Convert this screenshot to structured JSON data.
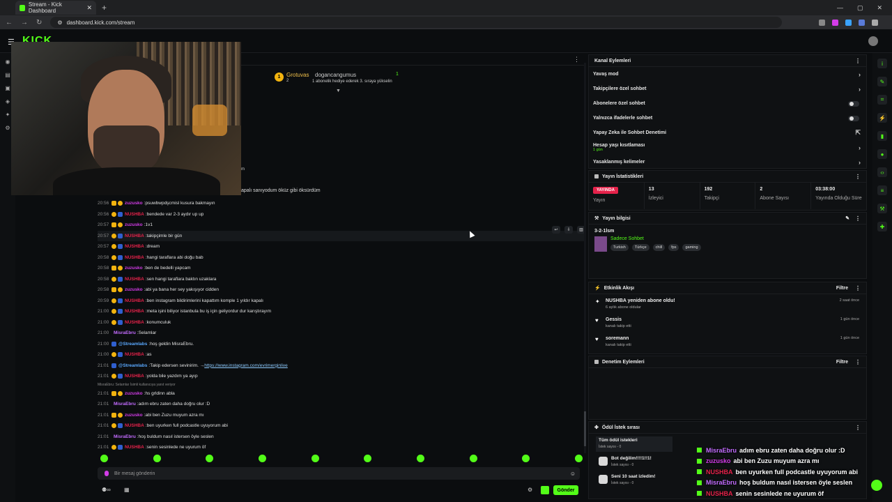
{
  "browser": {
    "tab_title": "Stream - Kick Dashboard",
    "url": "dashboard.kick.com/stream"
  },
  "site": {
    "logo": "KICK"
  },
  "pinned": {
    "rank": "1",
    "user1": "Grotuvas",
    "count1": "2",
    "user2": "dogancangumus",
    "count2": "1",
    "sub_text": "1 abonelik hediye ederek 3. sıraya yükselin"
  },
  "chat": {
    "fragment_top": "apalı sanıyodum öküz gibi öksürdüm",
    "fragment_mid": "m",
    "messages": [
      {
        "time": "20:56",
        "user": "zuzusko",
        "color": "#d33ce8",
        "badges": [
          "crown",
          "sub"
        ],
        "text": "psuwbwpdşcmisl kusura bakmayın"
      },
      {
        "time": "20:56",
        "user": "NUSHBA",
        "color": "#e5224a",
        "badges": [
          "sub",
          "blue"
        ],
        "text": "bendede var 2-3 aydır up up"
      },
      {
        "time": "20:57",
        "user": "zuzusko",
        "color": "#d33ce8",
        "badges": [
          "crown",
          "sub"
        ],
        "text": "1v1"
      },
      {
        "time": "20:57",
        "user": "NUSHBA",
        "color": "#e5224a",
        "badges": [
          "sub",
          "blue"
        ],
        "text": "takipçimle bir gün",
        "hl": true
      },
      {
        "time": "20:57",
        "user": "NUSHBA",
        "color": "#e5224a",
        "badges": [
          "sub",
          "blue"
        ],
        "text": "dream"
      },
      {
        "time": "20:58",
        "user": "NUSHBA",
        "color": "#e5224a",
        "badges": [
          "sub",
          "blue"
        ],
        "text": "hangi taraflara abi doğu bab"
      },
      {
        "time": "20:58",
        "user": "zuzusko",
        "color": "#d33ce8",
        "badges": [
          "crown",
          "sub"
        ],
        "text": "ben de bedelli yapcam"
      },
      {
        "time": "20:58",
        "user": "NUSHBA",
        "color": "#e5224a",
        "badges": [
          "sub",
          "blue"
        ],
        "text": "sen hangi taraflara baktın uzaklara"
      },
      {
        "time": "20:58",
        "user": "zuzusko",
        "color": "#d33ce8",
        "badges": [
          "crown",
          "sub"
        ],
        "text": "abi ya bana her sey yakışıyor cidden"
      },
      {
        "time": "20:59",
        "user": "NUSHBA",
        "color": "#e5224a",
        "badges": [
          "sub",
          "blue"
        ],
        "text": "ben instagram bildirimlerini kapattım komple 1 yıldır kapalı"
      },
      {
        "time": "21:00",
        "user": "NUSHBA",
        "color": "#e5224a",
        "badges": [
          "sub",
          "blue"
        ],
        "text": "meta işini biliyor istanbula bu iş için geliyordur dur karıştırayım"
      },
      {
        "time": "21:00",
        "user": "NUSHBA",
        "color": "#e5224a",
        "badges": [
          "sub",
          "blue"
        ],
        "text": "konumculuk"
      },
      {
        "time": "21:00",
        "user": "MisraEbru",
        "color": "#c36cff",
        "badges": [],
        "text": "Selamlar"
      },
      {
        "time": "21:00",
        "user": "@Streamlabs",
        "color": "#5aa9ff",
        "badges": [
          "bot"
        ],
        "text": "hoş geldin MisraEbru."
      },
      {
        "time": "21:00",
        "user": "NUSHBA",
        "color": "#e5224a",
        "badges": [
          "sub",
          "blue"
        ],
        "text": "as"
      },
      {
        "time": "21:01",
        "user": "@Streamlabs",
        "color": "#5aa9ff",
        "badges": [
          "bot"
        ],
        "text": "Takip edersen sevinirim. → ",
        "link": "https://www.instagram.com/evrimerginlive"
      },
      {
        "time": "21:01",
        "user": "NUSHBA",
        "color": "#e5224a",
        "badges": [
          "sub",
          "blue"
        ],
        "text": "yolda bile yazdım ya ayıp"
      },
      {
        "reply": "MisraEbru: Selamlar İsimli kullanıcıya yanıt veriyor"
      },
      {
        "time": "21:01",
        "user": "zuzusko",
        "color": "#d33ce8",
        "badges": [
          "crown",
          "sub"
        ],
        "text": "hs grldinn abla"
      },
      {
        "time": "21:01",
        "user": "MisraEbru",
        "color": "#c36cff",
        "badges": [],
        "text": "adım ebru zaten daha doğru olur :D"
      },
      {
        "time": "21:01",
        "user": "zuzusko",
        "color": "#d33ce8",
        "badges": [
          "crown",
          "sub"
        ],
        "text": "abi ben Zuzu muyum azra mı"
      },
      {
        "time": "21:01",
        "user": "NUSHBA",
        "color": "#e5224a",
        "badges": [
          "sub",
          "blue"
        ],
        "text": "ben uyurken full podcastle uyuyorum abi"
      },
      {
        "time": "21:01",
        "user": "MisraEbru",
        "color": "#c36cff",
        "badges": [],
        "text": "hoş buldum nasıl istersen öyle seslen"
      },
      {
        "time": "21:01",
        "user": "NUSHBA",
        "color": "#e5224a",
        "badges": [
          "sub",
          "blue"
        ],
        "text": "senin sesinlede ne uyurum öf"
      }
    ],
    "input_placeholder": "Bir mesaj gönderin",
    "send_label": "Gönder"
  },
  "channel_actions": {
    "title": "Kanal Eylemleri",
    "items": [
      {
        "label": "Yavaş mod",
        "kind": "chevron"
      },
      {
        "label": "Takipçilere özel sohbet",
        "kind": "chevron"
      },
      {
        "label": "Abonelere özel sohbet",
        "kind": "toggle"
      },
      {
        "label": "Yalnızca ifadelerle sohbet",
        "kind": "toggle"
      },
      {
        "label": "Yapay Zeka ile Sohbet Denetimi",
        "kind": "external"
      },
      {
        "label": "Hesap yaşı kısıtlaması",
        "kind": "chevron",
        "sub": "1 gün"
      },
      {
        "label": "Yasaklanmış kelimeler",
        "kind": "chevron"
      }
    ]
  },
  "stream_stats": {
    "title": "Yayın İstatistikleri",
    "live_badge": "YAYINDA",
    "live_label": "Yayın",
    "viewers": "13",
    "viewers_label": "İzleyici",
    "followers": "192",
    "followers_label": "Takipçi",
    "subs": "2",
    "subs_label": "Abone Sayısı",
    "uptime": "03:38:00",
    "uptime_label": "Yayında Olduğu Süre"
  },
  "stream_info": {
    "title": "Yayın bilgisi",
    "stream_title": "3-2-1lsm",
    "category": "Sadece Sohbet",
    "tags": [
      "Turkish",
      "Türkçe",
      "chill",
      "fps",
      "gaming"
    ]
  },
  "activity": {
    "title": "Etkinlik Akışı",
    "filter": "Filtre",
    "events": [
      {
        "title": "NUSHBA yeniden abone oldu!",
        "sub": "6 aylık abone oldular",
        "time": "2 saat önce",
        "icon": "star"
      },
      {
        "title": "Gessis",
        "sub": "kanalı takip etti",
        "time": "1 gün önce",
        "icon": "heart"
      },
      {
        "title": "soremann",
        "sub": "kanalı takip etti",
        "time": "1 gün önce",
        "icon": "heart"
      }
    ]
  },
  "moderation": {
    "title": "Denetim Eylemleri",
    "filter": "Filtre"
  },
  "rewards": {
    "title": "Ödül İstek sırası",
    "items": [
      {
        "title": "Tüm ödül istekleri",
        "sub": "İstek sayısı - 0",
        "selected": true
      },
      {
        "title": "Bot değilim!!!!1!!1!",
        "sub": "İstek sayısı - 0"
      },
      {
        "title": "Seni 10 saat izledim!",
        "sub": "İstek sayısı - 0"
      }
    ]
  },
  "overlay": {
    "lines": [
      {
        "user": "MisraEbru",
        "color": "#c36cff",
        "text": "adım ebru zaten daha doğru olur :D"
      },
      {
        "user": "zuzusko",
        "color": "#d33ce8",
        "text": "abi ben Zuzu muyum azra mı"
      },
      {
        "user": "NUSHBA",
        "color": "#e5224a",
        "text": "ben uyurken full podcastle uyuyorum abi"
      },
      {
        "user": "MisraEbru",
        "color": "#c36cff",
        "text": "hoş buldum nasıl istersen öyle seslen"
      },
      {
        "user": "NUSHBA",
        "color": "#e5224a",
        "text": "senin sesinlede ne uyurum öf"
      }
    ]
  },
  "colors": {
    "accent": "#53fc18",
    "live": "#e5224a"
  }
}
